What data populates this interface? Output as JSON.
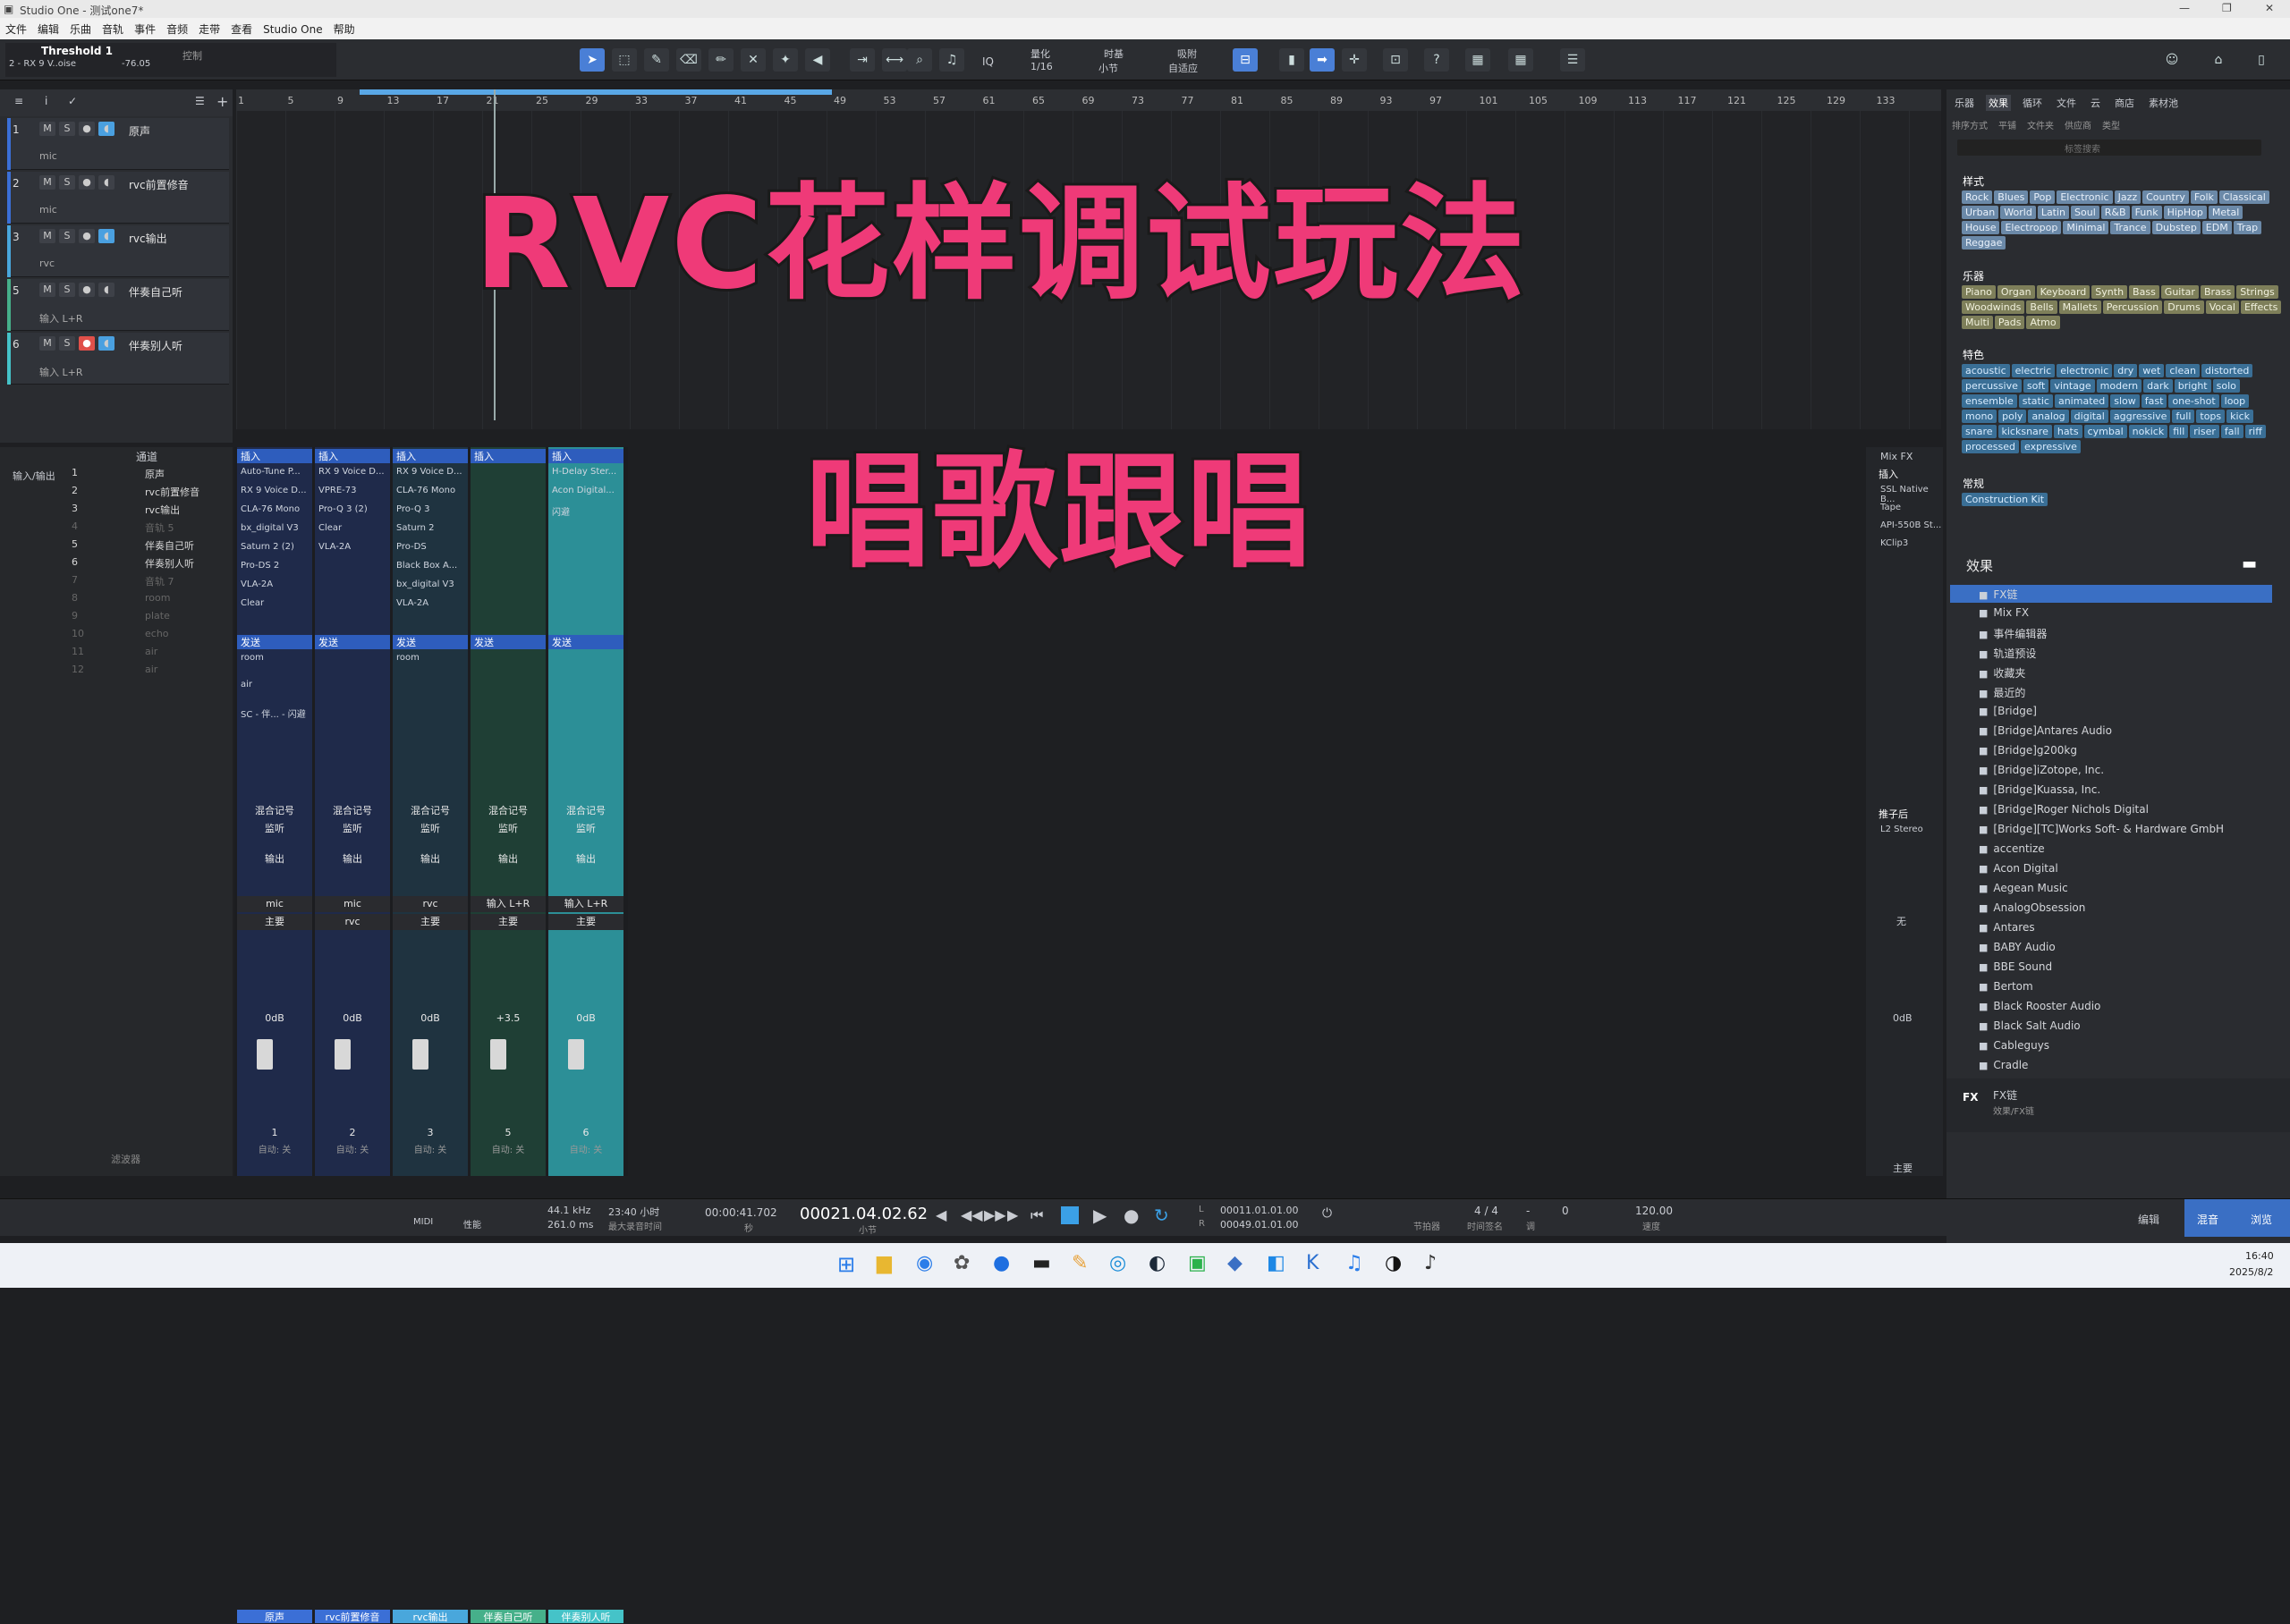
{
  "window": {
    "title": "Studio One - 测试one7*",
    "controls": [
      "—",
      "❐",
      "✕"
    ]
  },
  "menu": [
    "文件",
    "编辑",
    "乐曲",
    "音轨",
    "事件",
    "音频",
    "走带",
    "查看",
    "Studio One",
    "帮助"
  ],
  "inspector": {
    "name": "Threshold 1",
    "sub": "2 - RX 9 V..oise",
    "value": "-76.05",
    "mode": "控制"
  },
  "toolbar": {
    "quantize_label": "量化",
    "quantize_value": "1/16",
    "timebase_label": "时基",
    "timebase_value": "小节",
    "snap_label": "吸附",
    "snap_value": "自适应",
    "iq": "IQ"
  },
  "tracks": [
    {
      "num": "1",
      "name": "原声",
      "sub": "mic",
      "color": "#3b6fd6",
      "record": false
    },
    {
      "num": "2",
      "name": "rvc前置修音",
      "sub": "mic",
      "color": "#3b6fd6",
      "record": false
    },
    {
      "num": "3",
      "name": "rvc输出",
      "sub": "rvc",
      "color": "#49a7dc",
      "record": false
    },
    {
      "num": "5",
      "name": "伴奏自己听",
      "sub": "输入 L+R",
      "color": "#46b08a",
      "record": false
    },
    {
      "num": "6",
      "name": "伴奏别人听",
      "sub": "输入 L+R",
      "color": "#45c3c8",
      "record": true
    }
  ],
  "track_buttons": {
    "m": "M",
    "s": "S"
  },
  "ruler_ticks": [
    "1",
    "5",
    "9",
    "13",
    "17",
    "21",
    "25",
    "29",
    "33",
    "37",
    "41",
    "45",
    "49",
    "53",
    "57",
    "61",
    "65",
    "69",
    "73",
    "77",
    "81",
    "85",
    "89",
    "93",
    "97",
    "101",
    "105",
    "109",
    "113",
    "117",
    "121",
    "125",
    "129",
    "133"
  ],
  "overlay": {
    "title": "RVC花样调试玩法",
    "subtitle": "唱歌跟唱"
  },
  "tracklist": {
    "header": "通道",
    "items": [
      {
        "n": "1",
        "name": "原声"
      },
      {
        "n": "2",
        "name": "rvc前置修音"
      },
      {
        "n": "3",
        "name": "rvc输出"
      },
      {
        "n": "4",
        "name": "音轨 5"
      },
      {
        "n": "5",
        "name": "伴奏自己听"
      },
      {
        "n": "6",
        "name": "伴奏别人听"
      },
      {
        "n": "7",
        "name": "音轨 7"
      },
      {
        "n": "8",
        "name": "room"
      },
      {
        "n": "9",
        "name": "plate"
      },
      {
        "n": "10",
        "name": "echo"
      },
      {
        "n": "11",
        "name": "air"
      },
      {
        "n": "12",
        "name": "air"
      }
    ],
    "left_label": "输入/输出",
    "filter": "滤波器"
  },
  "strips": [
    {
      "hdr": "插入",
      "inserts": [
        "Auto-Tune P...",
        "RX 9 Voice D...",
        "CLA-76 Mono",
        "bx_digital V3",
        "Saturn 2 (2)",
        "Pro-DS 2",
        "VLA-2A",
        "Clear"
      ],
      "send_hdr": "发送",
      "sends": [
        "room",
        "air",
        "SC - 伴... - 闪避"
      ],
      "in": "mic",
      "out": "主要",
      "db": "0dB",
      "num": "1",
      "name": "原声",
      "color": "#3b6fd6",
      "bg": "#1f2a4a"
    },
    {
      "hdr": "插入",
      "inserts": [
        "RX 9 Voice D...",
        "VPRE-73",
        "Pro-Q 3 (2)",
        "Clear",
        "VLA-2A"
      ],
      "send_hdr": "发送",
      "sends": [],
      "in": "mic",
      "out": "rvc",
      "db": "0dB",
      "num": "2",
      "name": "rvc前置修音",
      "color": "#3b6fd6",
      "bg": "#1f2a4a"
    },
    {
      "hdr": "插入",
      "inserts": [
        "RX 9 Voice D...",
        "CLA-76 Mono",
        "Pro-Q 3",
        "Saturn 2",
        "Pro-DS",
        "Black Box A...",
        "bx_digital V3",
        "VLA-2A"
      ],
      "send_hdr": "发送",
      "sends": [
        "room"
      ],
      "in": "rvc",
      "out": "主要",
      "db": "0dB",
      "num": "3",
      "name": "rvc输出",
      "color": "#49a7dc",
      "bg": "#1f3340"
    },
    {
      "hdr": "插入",
      "inserts": [],
      "send_hdr": "发送",
      "sends": [],
      "in": "输入 L+R",
      "out": "主要",
      "db": "+3.5",
      "num": "5",
      "name": "伴奏自己听",
      "color": "#46b08a",
      "bg": "#1f3f35"
    },
    {
      "hdr": "插入",
      "inserts": [
        "H-Delay Ster...",
        "Acon Digital...",
        "闪避"
      ],
      "send_hdr": "发送",
      "sends": [],
      "in": "输入 L+R",
      "out": "主要",
      "db": "0dB",
      "num": "6",
      "name": "伴奏别人听",
      "color": "#45c3c8",
      "bg": "#2c8f97"
    }
  ],
  "strip_labels": {
    "mix_label": "混合记号",
    "listen": "监听",
    "output": "输出",
    "auto": "自动: 关"
  },
  "mixfx": {
    "title": "Mix FX",
    "insert": "插入",
    "items": [
      "SSL Native B...",
      "Tape",
      "API-550B St...",
      "KClip3"
    ],
    "post": "推子后",
    "post_item": "L2 Stereo",
    "none": "无",
    "db": "0dB",
    "footer": "主要"
  },
  "browser": {
    "tabs": [
      "乐器",
      "效果",
      "循环",
      "文件",
      "云",
      "商店",
      "素材池"
    ],
    "subtabs": [
      "排序方式",
      "平铺",
      "文件夹",
      "供应商",
      "类型"
    ],
    "search_placeholder": "标签搜索",
    "styles_title": "样式",
    "styles": [
      "Rock",
      "Blues",
      "Pop",
      "Electronic",
      "Jazz",
      "Country",
      "Folk",
      "Classical",
      "Urban",
      "World",
      "Latin",
      "Soul",
      "R&B",
      "Funk",
      "HipHop",
      "Metal",
      "House",
      "Electropop",
      "Minimal",
      "Trance",
      "Dubstep",
      "EDM",
      "Trap",
      "Reggae"
    ],
    "instruments_title": "乐器",
    "instruments": [
      "Piano",
      "Organ",
      "Keyboard",
      "Synth",
      "Bass",
      "Guitar",
      "Brass",
      "Strings",
      "Woodwinds",
      "Bells",
      "Mallets",
      "Percussion",
      "Drums",
      "Vocal",
      "Effects",
      "Multi",
      "Pads",
      "Atmo"
    ],
    "features_title": "特色",
    "features": [
      "acoustic",
      "electric",
      "electronic",
      "dry",
      "wet",
      "clean",
      "distorted",
      "percussive",
      "soft",
      "vintage",
      "modern",
      "dark",
      "bright",
      "solo",
      "ensemble",
      "static",
      "animated",
      "slow",
      "fast",
      "one-shot",
      "loop",
      "mono",
      "poly",
      "analog",
      "digital",
      "aggressive",
      "full",
      "tops",
      "kick",
      "snare",
      "kicksnare",
      "hats",
      "cymbal",
      "nokick",
      "fill",
      "riser",
      "fall",
      "riff",
      "processed",
      "expressive"
    ],
    "general_title": "常规",
    "general": [
      "Construction Kit"
    ],
    "effects_title": "效果",
    "tree": [
      "FX链",
      "Mix FX",
      "事件编辑器",
      "轨道预设",
      "收藏夹",
      "最近的",
      "[Bridge]",
      "[Bridge]Antares Audio",
      "[Bridge]g200kg",
      "[Bridge]iZotope, Inc.",
      "[Bridge]Kuassa, Inc.",
      "[Bridge]Roger Nichols Digital",
      "[Bridge][TC]Works Soft- & Hardware GmbH",
      "accentize",
      "Acon Digital",
      "Aegean Music",
      "AnalogObsession",
      "Antares",
      "BABY Audio",
      "BBE Sound",
      "Bertom",
      "Black Rooster Audio",
      "Black Salt Audio",
      "Cableguys",
      "Cradle"
    ],
    "footer_title": "FX链",
    "footer_sub": "效果/FX链"
  },
  "transport": {
    "midi": "MIDI",
    "perf": "性能",
    "rate": "44.1 kHz",
    "latency": "261.0 ms",
    "rec_time": "23:40 小时",
    "rec_label": "最大录音时间",
    "time": "00:00:41.702",
    "time_unit": "秒",
    "bars": "00021.04.02.62",
    "bars_unit": "小节",
    "loop_l": "00011.01.01.00",
    "loop_r": "00049.01.01.00",
    "sig": "4 / 4",
    "sig_label": "时间签名",
    "key": "-",
    "key_label": "调",
    "bpm": "120.00",
    "bpm_label": "速度",
    "nudge": "0",
    "nudge_label": "节拍器",
    "views": [
      "编辑",
      "混音",
      "浏览"
    ]
  },
  "taskbar": {
    "time": "16:40",
    "date": "2025/8/2"
  },
  "colors": {
    "accent": "#4a7fd6",
    "title": "#ef3a78"
  }
}
